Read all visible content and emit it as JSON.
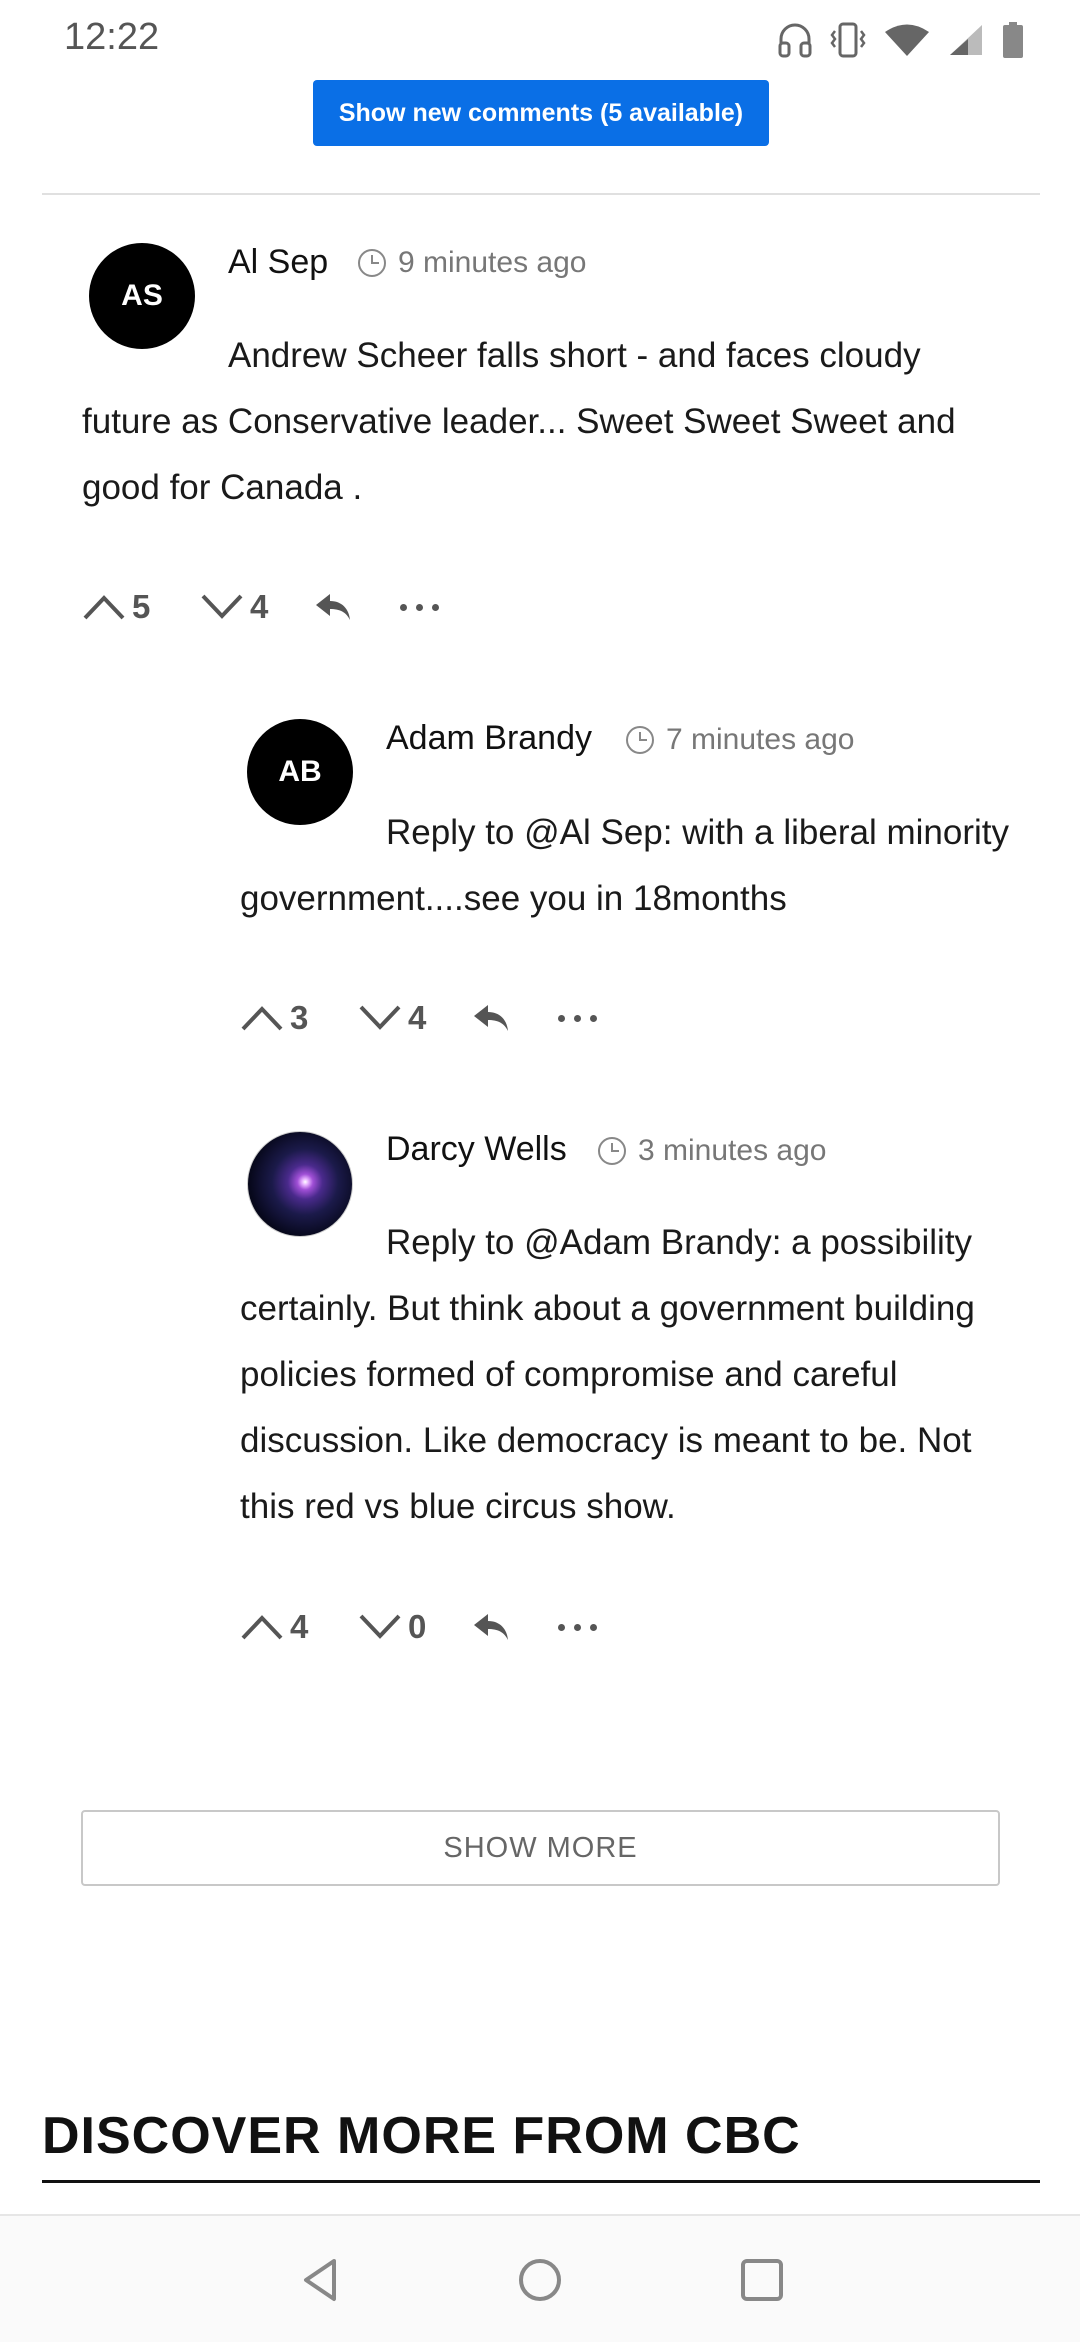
{
  "status_bar": {
    "time": "12:22",
    "icons": [
      "headphones-icon",
      "vibrate-icon",
      "wifi-icon",
      "signal-icon",
      "battery-icon"
    ]
  },
  "new_comments_button": "Show new comments (5 available)",
  "comments": [
    {
      "avatar_initials": "AS",
      "author": "Al Sep",
      "time": "9 minutes ago",
      "text": "Andrew Scheer falls short - and faces cloudy future as Conservative leader... Sweet Sweet Sweet and good for Canada .",
      "upvotes": "5",
      "downvotes": "4"
    },
    {
      "avatar_initials": "AB",
      "author": "Adam Brandy",
      "time": "7 minutes ago",
      "text": "Reply to @Al Sep: with a liberal minority government....see you in 18months",
      "upvotes": "3",
      "downvotes": "4"
    },
    {
      "avatar_initials": "",
      "author": "Darcy Wells",
      "time": "3 minutes ago",
      "text": "Reply to @Adam Brandy: a possibility certainly. But think about a government building policies formed of compromise and careful discussion. Like democracy is meant to be. Not this red vs blue circus show.",
      "upvotes": "4",
      "downvotes": "0"
    }
  ],
  "show_more_label": "SHOW MORE",
  "discover_title": "DISCOVER MORE FROM CBC",
  "colors": {
    "accent": "#0a6fe6",
    "avatar_bg": "#000000",
    "muted_text": "#777777"
  }
}
